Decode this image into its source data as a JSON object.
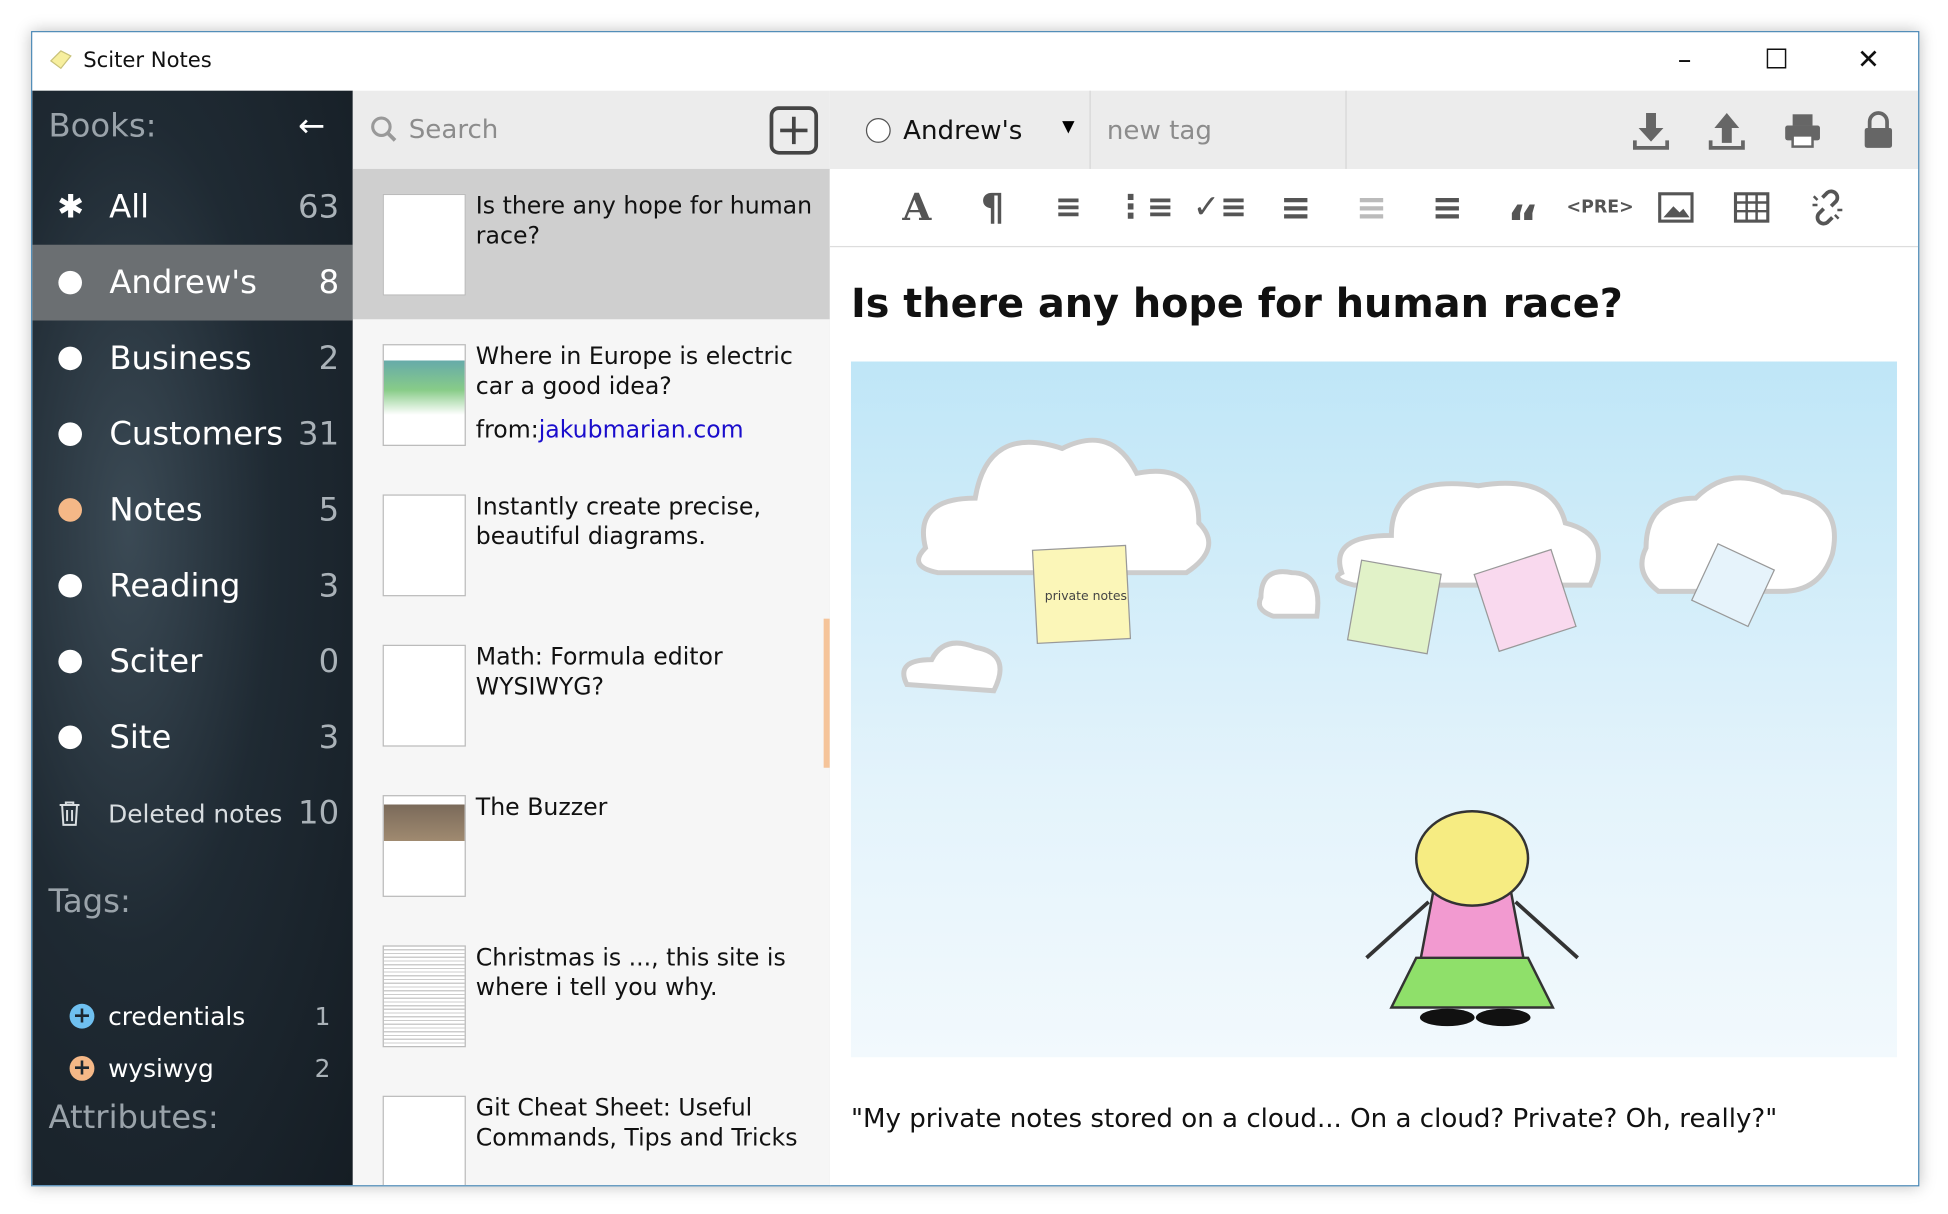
{
  "window": {
    "title": "Sciter Notes",
    "controls": [
      "minimize",
      "maximize",
      "close"
    ]
  },
  "sidebar": {
    "books_label": "Books:",
    "books": [
      {
        "label": "All",
        "count": "63",
        "icon": "asterisk-icon"
      },
      {
        "label": "Andrew's",
        "count": "8",
        "color": "#ffffff",
        "selected": true
      },
      {
        "label": "Business",
        "count": "2",
        "color": "#ffffff"
      },
      {
        "label": "Customers",
        "count": "31",
        "color": "#ffffff"
      },
      {
        "label": "Notes",
        "count": "5",
        "color": "#f5b887"
      },
      {
        "label": "Reading",
        "count": "3",
        "color": "#ffffff"
      },
      {
        "label": "Sciter",
        "count": "0",
        "color": "#ffffff"
      },
      {
        "label": "Site",
        "count": "3",
        "color": "#ffffff"
      }
    ],
    "deleted": {
      "label": "Deleted notes",
      "count": "10"
    },
    "tags_label": "Tags:",
    "tags": [
      {
        "label": "credentials",
        "count": "1",
        "color": "#6fc0f0"
      },
      {
        "label": "wysiwyg",
        "count": "2",
        "color": "#f5b887"
      }
    ],
    "attributes_label": "Attributes:"
  },
  "list": {
    "search_placeholder": "Search",
    "notes": [
      {
        "title": "Is there any hope for human race?",
        "selected": true
      },
      {
        "title": "Where in Europe is electric car a good idea?",
        "from_label": "from:",
        "from_link": "jakubmarian.com"
      },
      {
        "title": "Instantly create precise, beautiful diagrams."
      },
      {
        "title": "Math: Formula editor WYSIWYG?"
      },
      {
        "title": "The Buzzer"
      },
      {
        "title": "Christmas is ..., this site is where i tell you why."
      },
      {
        "title": "Git Cheat Sheet: Useful Commands, Tips and Tricks"
      }
    ]
  },
  "editor": {
    "book": "Andrew's",
    "new_tag_placeholder": "new tag",
    "pre_label": "<PRE>",
    "note_title": "Is there any hope for human race?",
    "image_notes": [
      "private notes"
    ],
    "caption": "\"My private notes stored on a cloud... On a cloud? Private? Oh, really?\""
  }
}
